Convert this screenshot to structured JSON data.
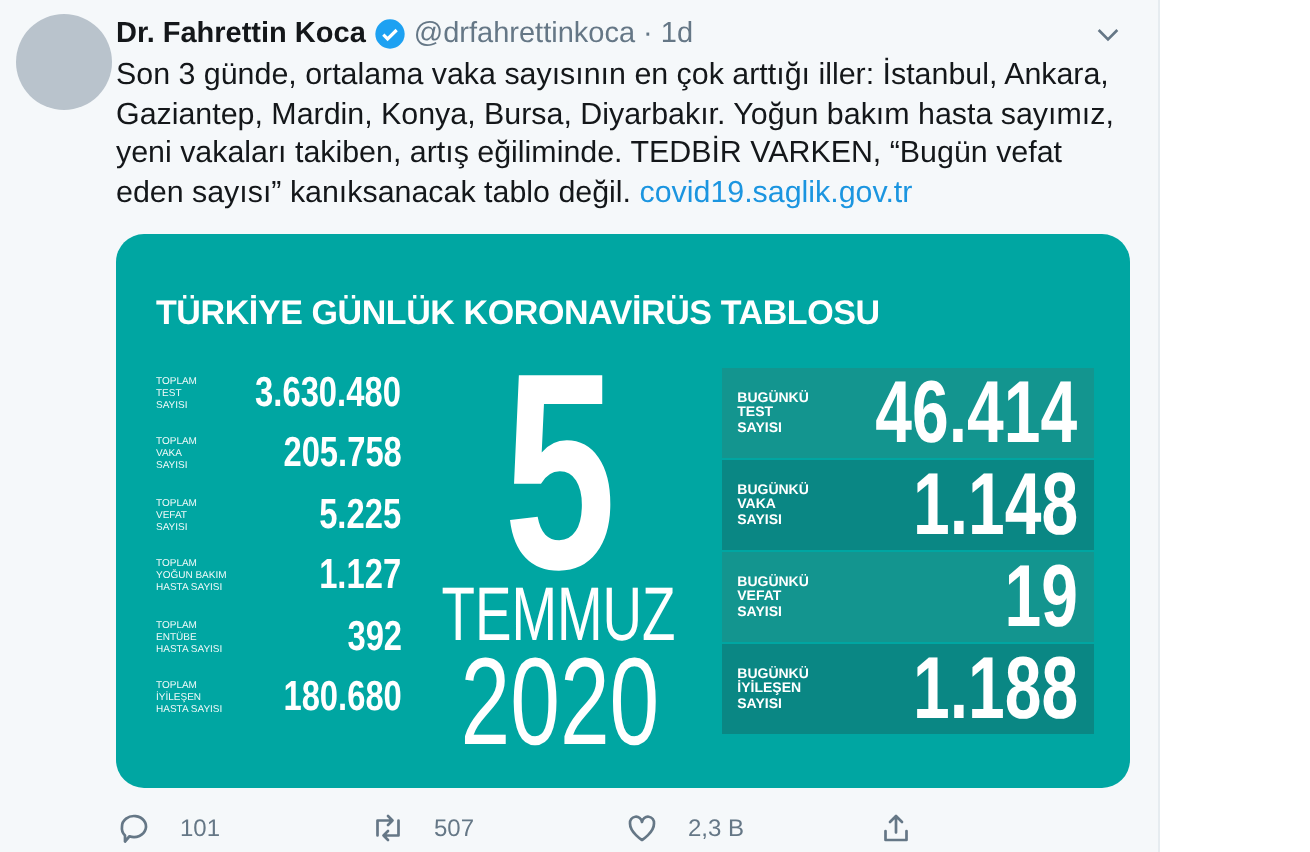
{
  "tweet": {
    "author": "Dr. Fahrettin Koca",
    "verified": true,
    "handle": "@drfahrettinkoca",
    "separator": "·",
    "time": "1d",
    "text": "Son 3 günde, ortalama vaka sayısının en çok arttığı iller: İstanbul, Ankara, Gaziantep, Mardin, Konya, Bursa, Diyarbakır. Yoğun bakım hasta sayımız, yeni vakaları takiben, artış eğiliminde. TEDBİR VARKEN, “Bugün vefat eden sayısı” kanıksanacak tablo değil.",
    "link": "covid19.saglik.gov.tr"
  },
  "infographic": {
    "title": "TÜRKİYE GÜNLÜK KORONAVİRÜS TABLOSU",
    "totals": [
      {
        "label": "TOPLAM\nTEST\nSAYISI",
        "value": "3.630.480"
      },
      {
        "label": "TOPLAM\nVAKA\nSAYISI",
        "value": "205.758"
      },
      {
        "label": "TOPLAM\nVEFAT\nSAYISI",
        "value": "5.225"
      },
      {
        "label": "TOPLAM\nYOĞUN BAKIM\nHASTA SAYISI",
        "value": "1.127"
      },
      {
        "label": "TOPLAM\nENTÜBE\nHASTA SAYISI",
        "value": "392"
      },
      {
        "label": "TOPLAM\nİYİLEŞEN\nHASTA SAYISI",
        "value": "180.680"
      }
    ],
    "date": {
      "day": "5",
      "month": "TEMMUZ",
      "year": "2020"
    },
    "today": [
      {
        "label": "BUGÜNKÜ\nTEST\nSAYISI",
        "value": "46.414"
      },
      {
        "label": "BUGÜNKÜ\nVAKA\nSAYISI",
        "value": "1.148"
      },
      {
        "label": "BUGÜNKÜ\nVEFAT\nSAYISI",
        "value": "19"
      },
      {
        "label": "BUGÜNKÜ\nİYİLEŞEN\nSAYISI",
        "value": "1.188"
      }
    ]
  },
  "actions": [
    {
      "kind": "reply",
      "count": "101"
    },
    {
      "kind": "retweet",
      "count": "507"
    },
    {
      "kind": "like",
      "count": "2,3 B"
    },
    {
      "kind": "share"
    }
  ]
}
